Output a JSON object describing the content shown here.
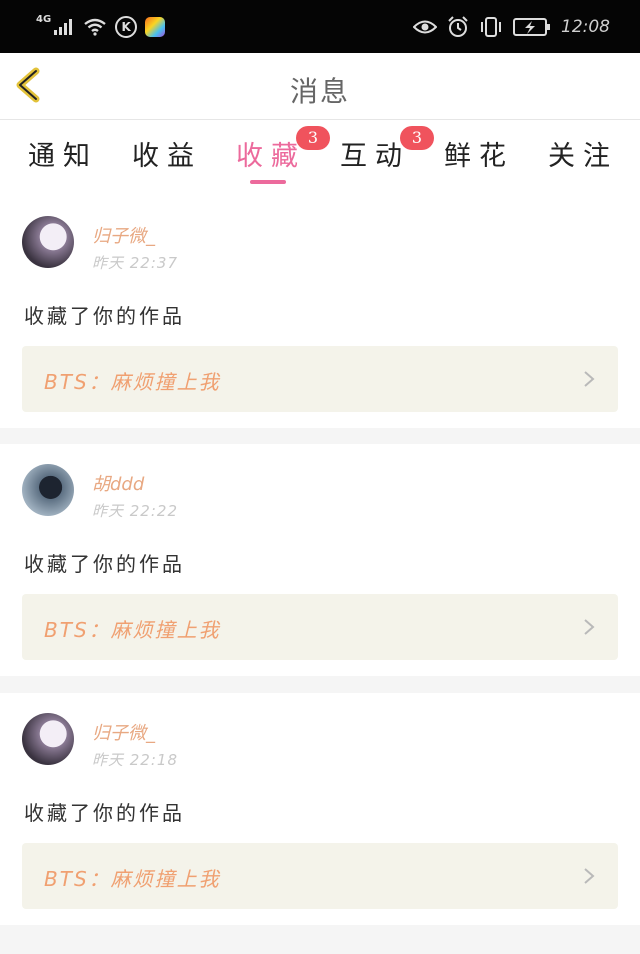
{
  "status_bar": {
    "network": "4G",
    "time": "12:08"
  },
  "header": {
    "title": "消息"
  },
  "tabs": [
    {
      "label": "通知",
      "badge": ""
    },
    {
      "label": "收益",
      "badge": ""
    },
    {
      "label": "收藏",
      "badge": "3",
      "active": true
    },
    {
      "label": "互动",
      "badge": "3"
    },
    {
      "label": "鲜花",
      "badge": ""
    },
    {
      "label": "关注",
      "badge": ""
    }
  ],
  "notifications": [
    {
      "user": "归子微_",
      "time": "昨天 22:37",
      "action": "收藏了你的作品",
      "work": "BTS：麻烦撞上我"
    },
    {
      "user": "胡ddd",
      "time": "昨天 22:22",
      "action": "收藏了你的作品",
      "work": "BTS：麻烦撞上我"
    },
    {
      "user": "归子微_",
      "time": "昨天 22:18",
      "action": "收藏了你的作品",
      "work": "BTS：麻烦撞上我"
    }
  ],
  "colors": {
    "accent": "#ec6a9c",
    "badge": "#f0535d",
    "username": "#e8a882",
    "work_title": "#f0a071",
    "back_arrow": "#e2c23a"
  }
}
